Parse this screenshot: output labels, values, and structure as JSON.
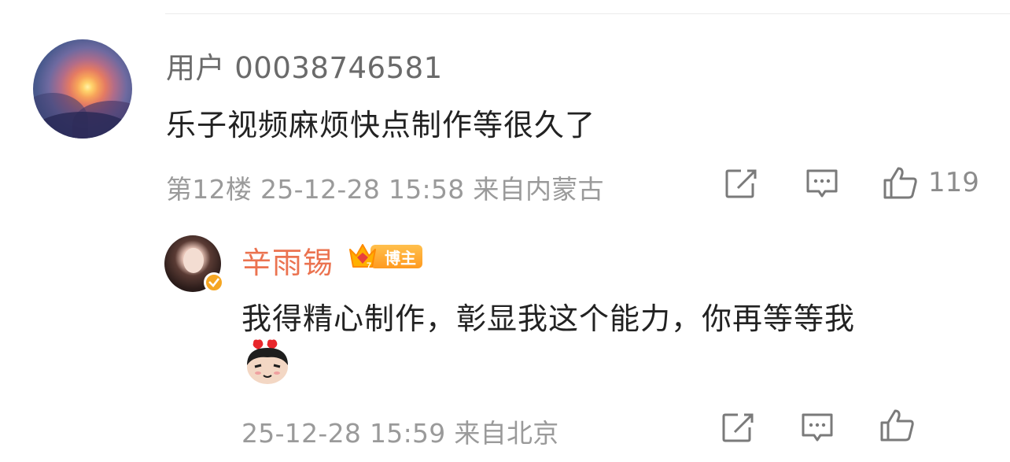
{
  "comment": {
    "username": "用户 00038746581",
    "text": "乐子视频麻烦快点制作等很久了",
    "meta": "第12楼 25-12-28 15:58 来自内蒙古",
    "like_count": "119"
  },
  "reply": {
    "username": "辛雨锡",
    "badge_label": "博主",
    "badge_level": "7",
    "text": "我得精心制作，彰显我这个能力，你再等等我",
    "meta": "25-12-28 15:59 来自北京"
  },
  "icons": {
    "share": "share-icon",
    "comment": "comment-icon",
    "like": "thumbs-up-icon",
    "verified": "verified-icon",
    "emoji": "love-face-emoji"
  },
  "colors": {
    "reply_name": "#eb7350",
    "meta": "#9a9a9a",
    "badge": "#ff9a1f"
  }
}
